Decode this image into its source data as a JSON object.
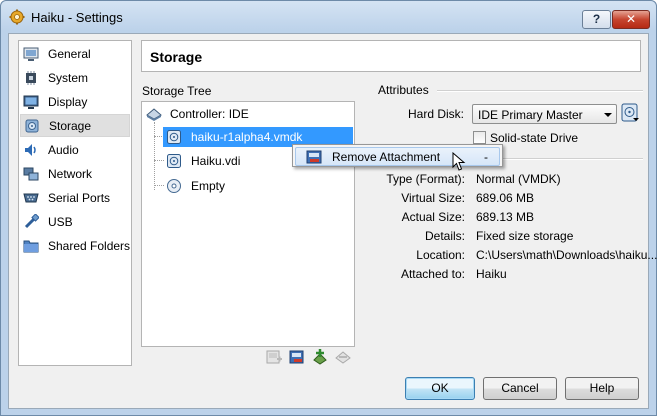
{
  "window": {
    "title": "Haiku - Settings",
    "help_label": "?",
    "close_label": "✕"
  },
  "nav": {
    "items": [
      {
        "label": "General",
        "icon": "general-icon",
        "selected": false
      },
      {
        "label": "System",
        "icon": "chip-icon",
        "selected": false
      },
      {
        "label": "Display",
        "icon": "monitor-icon",
        "selected": false
      },
      {
        "label": "Storage",
        "icon": "disk-icon",
        "selected": true
      },
      {
        "label": "Audio",
        "icon": "speaker-icon",
        "selected": false
      },
      {
        "label": "Network",
        "icon": "network-icon",
        "selected": false
      },
      {
        "label": "Serial Ports",
        "icon": "serial-port-icon",
        "selected": false
      },
      {
        "label": "USB",
        "icon": "usb-icon",
        "selected": false
      },
      {
        "label": "Shared Folders",
        "icon": "folder-icon",
        "selected": false
      }
    ]
  },
  "page": {
    "title": "Storage"
  },
  "storage_tree": {
    "label": "Storage Tree",
    "controller": "Controller: IDE",
    "items": [
      {
        "label": "haiku-r1alpha4.vmdk",
        "icon": "hard-disk-icon",
        "selected": true
      },
      {
        "label": "Haiku.vdi",
        "icon": "hard-disk-icon",
        "selected": false
      },
      {
        "label": "Empty",
        "icon": "optical-disc-icon",
        "selected": false
      }
    ],
    "toolbar": [
      "add-controller-icon",
      "remove-controller-icon",
      "add-attachment-icon",
      "remove-attachment-icon"
    ]
  },
  "attributes": {
    "label": "Attributes",
    "hard_disk_label": "Hard Disk:",
    "hard_disk_value": "IDE Primary Master",
    "ssd_label": "Solid-state Drive",
    "ssd_checked": false,
    "info": [
      {
        "label": "Type (Format):",
        "value": "Normal (VMDK)"
      },
      {
        "label": "Virtual Size:",
        "value": "689.06 MB"
      },
      {
        "label": "Actual Size:",
        "value": "689.13 MB"
      },
      {
        "label": "Details:",
        "value": "Fixed size storage"
      },
      {
        "label": "Location:",
        "value": "C:\\Users\\math\\Downloads\\haiku..."
      },
      {
        "label": "Attached to:",
        "value": "Haiku"
      }
    ]
  },
  "context_menu": {
    "items": [
      {
        "label": "Remove Attachment",
        "shortcut": "-",
        "icon": "remove-attachment-icon"
      }
    ]
  },
  "buttons": {
    "ok": "OK",
    "cancel": "Cancel",
    "help": "Help"
  },
  "colors": {
    "selection": "#3399ff",
    "title_bar": "#bcd2ea",
    "close_button": "#c6452f"
  }
}
